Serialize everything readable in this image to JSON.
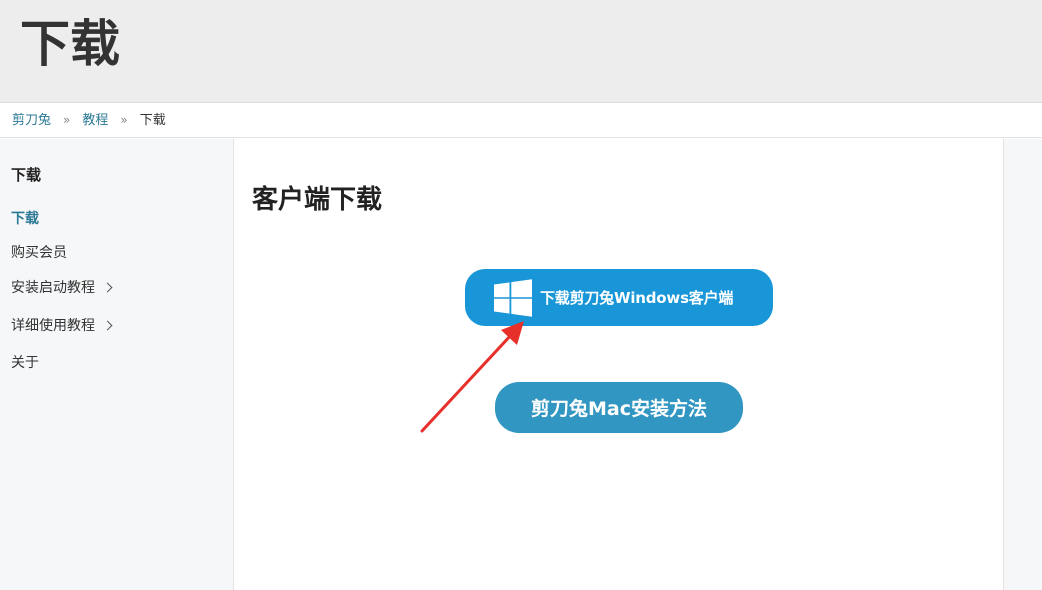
{
  "hero": {
    "title": "下载"
  },
  "breadcrumb": {
    "items": [
      "剪刀兔",
      "教程"
    ],
    "separator": "»",
    "current": "下载"
  },
  "sidebar": {
    "title": "下载",
    "items": [
      {
        "label": "下载",
        "active": true
      },
      {
        "label": "购买会员"
      },
      {
        "label": "安装启动教程",
        "expandable": true
      },
      {
        "label": "详细使用教程",
        "expandable": true
      },
      {
        "label": "关于"
      }
    ]
  },
  "main": {
    "heading": "客户端下载",
    "windows_button": {
      "label": "下载剪刀兔Windows客户端",
      "icon": "windows-logo-icon"
    },
    "mac_button": {
      "label": "剪刀兔Mac安装方法"
    }
  },
  "annotation": {
    "type": "red-arrow",
    "color": "#e8302a"
  },
  "colors": {
    "link": "#2c7a96",
    "windows_button": "#1996d8",
    "mac_button": "#3196c1"
  }
}
